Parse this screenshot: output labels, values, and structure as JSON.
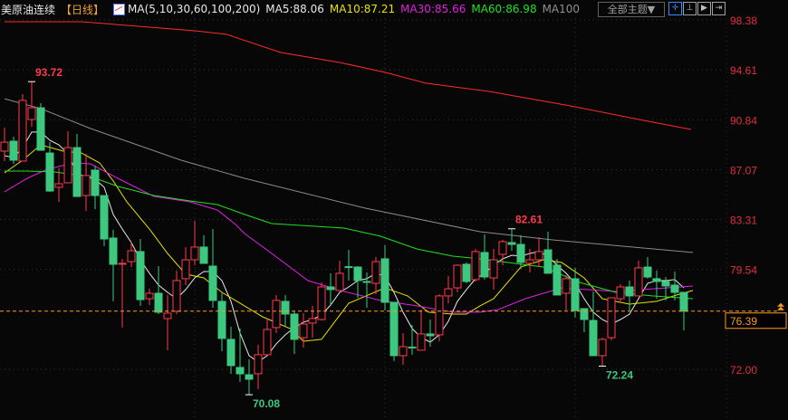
{
  "header": {
    "title": "美原油连续",
    "period": "【日线】",
    "ma_def": "MA(5,10,30,60,100,200)",
    "ma5": "MA5:88.06",
    "ma10": "MA10:87.21",
    "ma30": "MA30:85.66",
    "ma60": "MA60:86.98",
    "ma100": "MA100",
    "theme_button": "全部主题▼",
    "tool_icons": [
      "crosshair-icon",
      "zoom-range-icon",
      "play-range-icon",
      "exit-icon"
    ]
  },
  "colors": {
    "up": "#ff3a4c",
    "down": "#3cc87f",
    "ma5": "#e8e8e8",
    "ma10": "#e8e000",
    "ma30": "#e020e0",
    "ma60": "#20e020",
    "ma100": "#8a8a8a",
    "ma200": "#ff2a2a",
    "price_line": "#ff9a20"
  },
  "chart_data": {
    "type": "candlestick",
    "y_ticks": [
      "98.38",
      "94.61",
      "90.84",
      "87.07",
      "83.31",
      "79.54",
      "72.00"
    ],
    "ylim": [
      69.5,
      98.9
    ],
    "current_price": "76.39",
    "annotations": [
      {
        "text": "93.72",
        "index": 3,
        "value": 93.72,
        "kind": "high"
      },
      {
        "text": "82.61",
        "index": 56,
        "value": 82.61,
        "kind": "high"
      },
      {
        "text": "70.08",
        "index": 27,
        "value": 70.08,
        "kind": "low"
      },
      {
        "text": "72.24",
        "index": 66,
        "value": 72.24,
        "kind": "low"
      }
    ],
    "candles": [
      [
        88.47,
        90.25,
        87.72,
        89.15
      ],
      [
        89.22,
        89.56,
        87.51,
        87.79
      ],
      [
        87.72,
        92.78,
        87.72,
        92.3
      ],
      [
        90.86,
        93.72,
        90.32,
        91.75
      ],
      [
        91.75,
        92.09,
        88.54,
        88.54
      ],
      [
        88.33,
        89.15,
        85.4,
        85.46
      ],
      [
        85.74,
        87.17,
        84.64,
        86.01
      ],
      [
        86.08,
        89.97,
        86.08,
        88.74
      ],
      [
        88.74,
        89.77,
        85.05,
        85.05
      ],
      [
        85.12,
        88.27,
        83.96,
        86.63
      ],
      [
        87.04,
        87.38,
        84.1,
        85.12
      ],
      [
        85.12,
        85.12,
        81.3,
        81.84
      ],
      [
        81.91,
        82.53,
        77.13,
        79.93
      ],
      [
        79.97,
        80.34,
        75.15,
        80.0
      ],
      [
        80.13,
        81.64,
        79.72,
        80.95
      ],
      [
        80.89,
        81.84,
        76.79,
        77.26
      ],
      [
        77.33,
        78.08,
        76.85,
        77.74
      ],
      [
        77.74,
        79.79,
        76.17,
        76.31
      ],
      [
        75.83,
        77.61,
        73.44,
        76.24
      ],
      [
        76.38,
        79.45,
        76.17,
        78.7
      ],
      [
        78.84,
        81.23,
        78.36,
        80.27
      ],
      [
        80.27,
        83.21,
        79.86,
        81.23
      ],
      [
        81.23,
        82.12,
        80.0,
        80.0
      ],
      [
        79.79,
        82.59,
        76.65,
        77.2
      ],
      [
        77.13,
        77.74,
        73.37,
        74.33
      ],
      [
        74.26,
        75.21,
        71.66,
        72.28
      ],
      [
        72.14,
        75.08,
        71.05,
        71.66
      ],
      [
        71.59,
        72.75,
        70.08,
        71.25
      ],
      [
        71.66,
        73.85,
        70.5,
        73.1
      ],
      [
        73.1,
        75.83,
        73.1,
        75.01
      ],
      [
        75.15,
        77.61,
        74.74,
        77.2
      ],
      [
        77.13,
        77.61,
        75.21,
        76.17
      ],
      [
        76.17,
        76.44,
        73.16,
        74.26
      ],
      [
        74.39,
        76.24,
        73.64,
        75.42
      ],
      [
        75.49,
        76.79,
        74.39,
        75.83
      ],
      [
        75.76,
        78.56,
        75.69,
        78.22
      ],
      [
        78.22,
        79.25,
        76.85,
        78.02
      ],
      [
        77.95,
        80.2,
        77.95,
        79.25
      ],
      [
        79.75,
        81.02,
        78.7,
        79.72
      ],
      [
        79.72,
        79.79,
        77.4,
        78.7
      ],
      [
        78.63,
        79.31,
        76.65,
        78.56
      ],
      [
        78.49,
        80.48,
        77.67,
        80.13
      ],
      [
        80.34,
        81.36,
        76.44,
        77.06
      ],
      [
        77.06,
        77.06,
        72.62,
        73.03
      ],
      [
        73.03,
        74.74,
        72.34,
        73.71
      ],
      [
        73.68,
        75.35,
        73.1,
        73.64
      ],
      [
        73.44,
        76.51,
        73.44,
        74.67
      ],
      [
        74.67,
        75.76,
        73.71,
        74.53
      ],
      [
        74.6,
        77.67,
        74.12,
        77.54
      ],
      [
        77.54,
        79.04,
        76.99,
        78.08
      ],
      [
        78.15,
        79.93,
        77.81,
        79.86
      ],
      [
        79.93,
        80.07,
        78.49,
        78.63
      ],
      [
        78.77,
        81.09,
        78.63,
        80.89
      ],
      [
        80.82,
        82.18,
        78.77,
        78.97
      ],
      [
        78.9,
        81.09,
        78.02,
        80.27
      ],
      [
        80.68,
        81.77,
        79.86,
        81.64
      ],
      [
        81.57,
        82.61,
        80.95,
        81.43
      ],
      [
        81.43,
        82.12,
        79.59,
        80.07
      ],
      [
        80.0,
        81.09,
        79.31,
        80.27
      ],
      [
        80.27,
        81.98,
        79.72,
        80.89
      ],
      [
        81.02,
        82.39,
        79.25,
        79.25
      ],
      [
        79.86,
        80.34,
        77.61,
        77.61
      ],
      [
        77.74,
        79.11,
        76.44,
        78.84
      ],
      [
        78.84,
        79.66,
        75.9,
        76.44
      ],
      [
        76.58,
        76.58,
        74.8,
        75.76
      ],
      [
        75.69,
        77.88,
        73.03,
        73.03
      ],
      [
        73.03,
        74.39,
        72.24,
        74.26
      ],
      [
        74.39,
        77.4,
        74.19,
        77.4
      ],
      [
        77.33,
        78.43,
        77.06,
        78.22
      ],
      [
        78.22,
        78.7,
        76.44,
        77.54
      ],
      [
        77.54,
        80.2,
        77.54,
        79.66
      ],
      [
        79.72,
        80.48,
        78.84,
        78.97
      ],
      [
        78.84,
        79.45,
        77.33,
        78.63
      ],
      [
        78.63,
        78.97,
        77.2,
        78.29
      ],
      [
        78.36,
        79.38,
        77.2,
        77.81
      ],
      [
        77.81,
        77.81,
        74.94,
        76.39
      ]
    ],
    "series": [
      {
        "name": "MA5",
        "values": [
          88.13,
          87.99,
          88.74,
          89.91,
          89.91,
          89.29,
          88.95,
          88.27,
          86.76,
          86.56,
          86.35,
          85.74,
          83.69,
          82.59,
          81.57,
          80.27,
          79.25,
          78.36,
          77.81,
          77.33,
          78.02,
          78.9,
          79.38,
          79.38,
          78.7,
          77.13,
          74.74,
          73.03,
          72.55,
          73.03,
          73.92,
          74.6,
          75.15,
          75.56,
          75.76,
          76.1,
          76.85,
          77.81,
          78.22,
          78.7,
          78.84,
          79.25,
          79.04,
          77.81,
          76.31,
          75.08,
          74.39,
          74.05,
          74.6,
          75.62,
          77.13,
          78.02,
          78.84,
          79.25,
          79.86,
          80.34,
          80.61,
          80.54,
          80.75,
          80.89,
          80.54,
          79.86,
          79.25,
          78.49,
          77.33,
          76.31,
          75.76,
          75.42,
          75.76,
          76.17,
          77.33,
          78.49,
          78.7,
          78.7,
          78.77,
          78.15
        ]
      },
      {
        "name": "MA10",
        "points": [
          [
            0,
            86.83
          ],
          [
            2,
            87.79
          ],
          [
            4,
            88.95
          ],
          [
            6.5,
            88.47
          ],
          [
            8.5,
            88.33
          ],
          [
            10.5,
            87.58
          ],
          [
            12,
            86.22
          ],
          [
            13.5,
            84.64
          ],
          [
            16,
            82.59
          ],
          [
            18,
            80.75
          ],
          [
            20,
            79.18
          ],
          [
            22,
            78.9
          ],
          [
            24,
            77.81
          ],
          [
            25.5,
            77.2
          ],
          [
            28.5,
            75.96
          ],
          [
            31.5,
            75.08
          ],
          [
            33,
            74.12
          ],
          [
            35,
            74.26
          ],
          [
            38,
            76.99
          ],
          [
            42,
            78.15
          ],
          [
            44.5,
            77.54
          ],
          [
            46.8,
            76.31
          ],
          [
            49.5,
            76.17
          ],
          [
            51,
            76.17
          ],
          [
            52.5,
            76.79
          ],
          [
            54,
            77.33
          ],
          [
            57,
            79.72
          ],
          [
            59.5,
            80.27
          ],
          [
            61.5,
            80.07
          ],
          [
            64,
            78.9
          ],
          [
            66,
            77.33
          ],
          [
            69,
            76.92
          ],
          [
            72,
            77.13
          ],
          [
            74.5,
            77.67
          ],
          [
            76,
            77.95
          ]
        ]
      },
      {
        "name": "MA30",
        "points": [
          [
            0,
            85.4
          ],
          [
            2.5,
            86.42
          ],
          [
            4.5,
            87.04
          ],
          [
            7.5,
            87.58
          ],
          [
            9.5,
            87.51
          ],
          [
            12.5,
            86.42
          ],
          [
            16.5,
            85.05
          ],
          [
            20.5,
            84.64
          ],
          [
            23.5,
            84.03
          ],
          [
            25.5,
            82.94
          ],
          [
            26.5,
            82.25
          ],
          [
            29.5,
            80.75
          ],
          [
            33.5,
            78.7
          ],
          [
            37.5,
            77.88
          ],
          [
            41.5,
            77.2
          ],
          [
            45.5,
            76.79
          ],
          [
            49.5,
            76.31
          ],
          [
            52.5,
            76.31
          ],
          [
            54.5,
            76.51
          ],
          [
            57.5,
            77.33
          ],
          [
            61.5,
            78.15
          ],
          [
            67.5,
            77.88
          ],
          [
            76,
            78.29
          ]
        ]
      },
      {
        "name": "MA60",
        "points": [
          [
            0,
            86.97
          ],
          [
            2.5,
            86.97
          ],
          [
            5.5,
            86.9
          ],
          [
            9.5,
            86.56
          ],
          [
            12.5,
            85.81
          ],
          [
            16.5,
            85.12
          ],
          [
            20.5,
            84.71
          ],
          [
            23.5,
            84.44
          ],
          [
            26.5,
            83.69
          ],
          [
            29.5,
            83.0
          ],
          [
            37.5,
            82.66
          ],
          [
            41.5,
            82.05
          ],
          [
            45.5,
            81.09
          ],
          [
            49.5,
            80.54
          ],
          [
            52.5,
            80.34
          ],
          [
            55.5,
            80.07
          ],
          [
            59.5,
            79.72
          ],
          [
            63.5,
            78.56
          ],
          [
            67.5,
            77.81
          ],
          [
            71.5,
            77.54
          ],
          [
            76,
            77.33
          ]
        ]
      },
      {
        "name": "MA100",
        "points": [
          [
            0,
            92.43
          ],
          [
            4,
            91.68
          ],
          [
            9.5,
            90.18
          ],
          [
            19.5,
            87.79
          ],
          [
            26.5,
            86.42
          ],
          [
            39.8,
            84.17
          ],
          [
            52.5,
            82.39
          ],
          [
            60.5,
            81.77
          ],
          [
            76,
            80.82
          ]
        ]
      },
      {
        "name": "MA200",
        "points": [
          [
            0,
            98.24
          ],
          [
            8.5,
            98.24
          ],
          [
            21,
            97.56
          ],
          [
            24.5,
            97.29
          ],
          [
            30.5,
            95.92
          ],
          [
            37,
            95.17
          ],
          [
            42,
            94.42
          ],
          [
            46.5,
            93.6
          ],
          [
            53.5,
            92.98
          ],
          [
            62.5,
            91.89
          ],
          [
            71,
            90.73
          ],
          [
            75.8,
            90.11
          ]
        ]
      }
    ]
  }
}
